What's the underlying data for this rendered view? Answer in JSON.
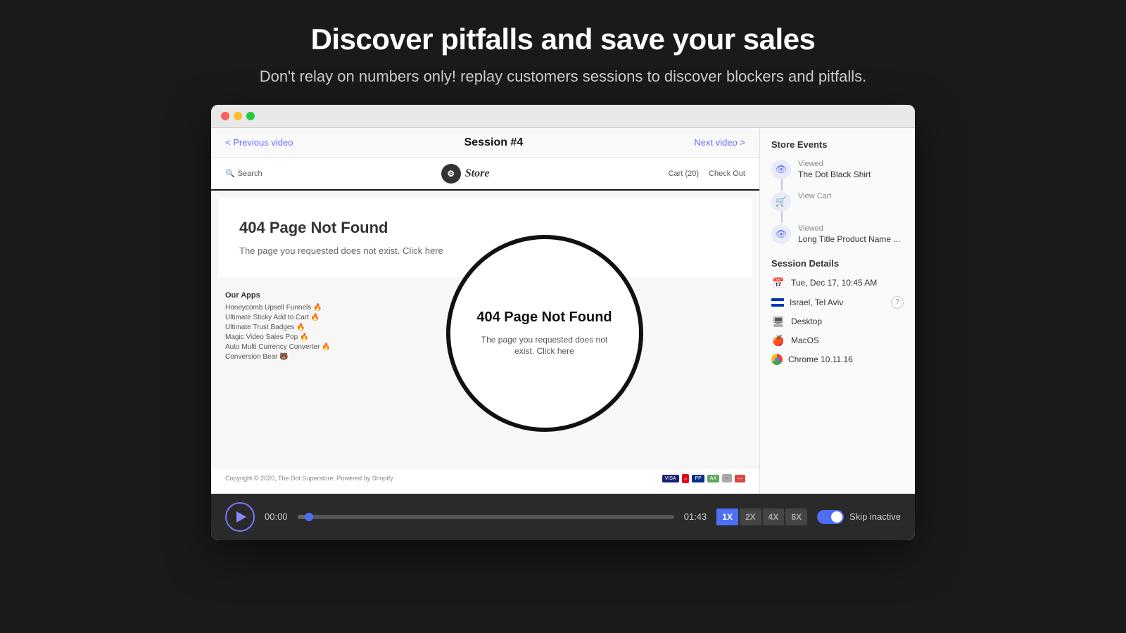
{
  "header": {
    "title": "Discover pitfalls and save your sales",
    "subtitle": "Don't relay on numbers only! replay customers sessions to discover blockers and pitfalls."
  },
  "browser": {
    "titlebar": {
      "dots": [
        "red",
        "yellow",
        "green"
      ]
    },
    "session_nav": {
      "prev_label": "< Previous video",
      "session_label": "Session #4",
      "next_label": "Next video >"
    },
    "store": {
      "search_placeholder": "Search",
      "logo_text": "Store",
      "cart_label": "Cart (20)",
      "checkout_label": "Check Out"
    },
    "page_404": {
      "title": "404 Page Not Found",
      "description": "The page you requested does not exist. Click here"
    },
    "our_apps": {
      "title": "Our Apps",
      "items": [
        "Honeycomb Upsell Funnels 🔥",
        "Ultimate Sticky Add to Cart 🔥",
        "Ultimate Trust Badges 🔥",
        "Magic Video Sales Pop 🔥",
        "Auto Multi Currency Converter 🔥",
        "Conversion Bear 🐻"
      ]
    },
    "footer": {
      "copyright": "Copyright © 2020, The Dot Superstore. Powered by Shopify"
    }
  },
  "sidebar": {
    "store_events_title": "Store Events",
    "events": [
      {
        "action": "Viewed",
        "name": "The Dot Black Shirt",
        "icon": "eye"
      },
      {
        "action": "View Cart",
        "name": "",
        "icon": "cart"
      },
      {
        "action": "Viewed",
        "name": "Long Title Product Name ...",
        "icon": "eye"
      }
    ],
    "session_details_title": "Session Details",
    "details": {
      "datetime": "Tue, Dec 17, 10:45 AM",
      "location": "Israel, Tel Aviv",
      "device": "Desktop",
      "os": "MacOS",
      "browser": "Chrome 10.11.16"
    }
  },
  "player": {
    "time_start": "00:00",
    "time_end": "01:43",
    "speeds": [
      {
        "label": "1X",
        "active": true
      },
      {
        "label": "2X",
        "active": false
      },
      {
        "label": "4X",
        "active": false
      },
      {
        "label": "8X",
        "active": false
      }
    ],
    "skip_inactive_label": "Skip inactive",
    "progress_percent": 3
  }
}
